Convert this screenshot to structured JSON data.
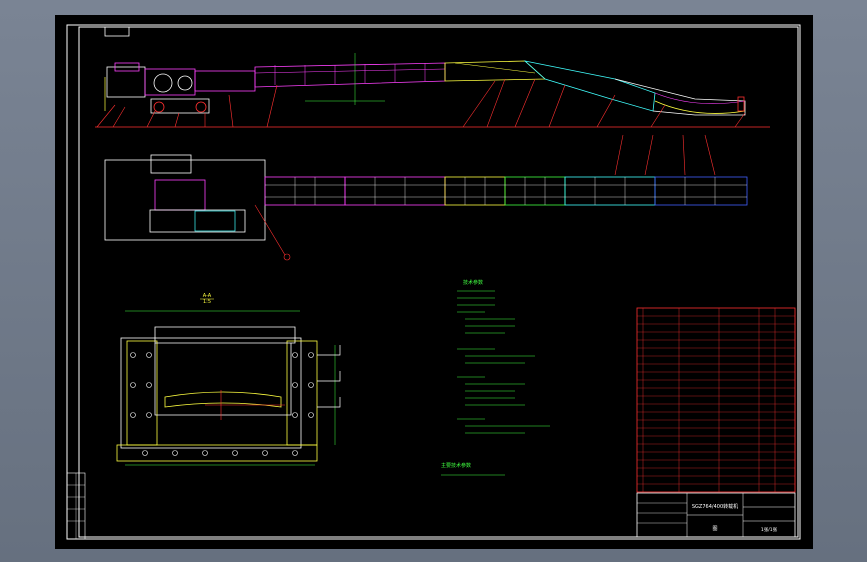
{
  "drawing": {
    "tag_label": "",
    "title_block_name": "SGZ764/400转载机",
    "title_block_code": "",
    "title_block_bottom_left": "图",
    "title_block_bottom_right": "1张/1张"
  },
  "views": {
    "section_label_top": "A-A",
    "section_label_bottom": "1:5"
  },
  "tech_params": {
    "title": "技术参数",
    "footer": "主要技术参数"
  },
  "colors": {
    "sheet_bg": "#000000",
    "frame": "#ffffff",
    "red": "#ff3030",
    "magenta": "#ff40ff",
    "yellow": "#ffff40",
    "green": "#40ff40",
    "cyan": "#40ffff",
    "blue": "#4060ff",
    "white": "#ffffff"
  }
}
